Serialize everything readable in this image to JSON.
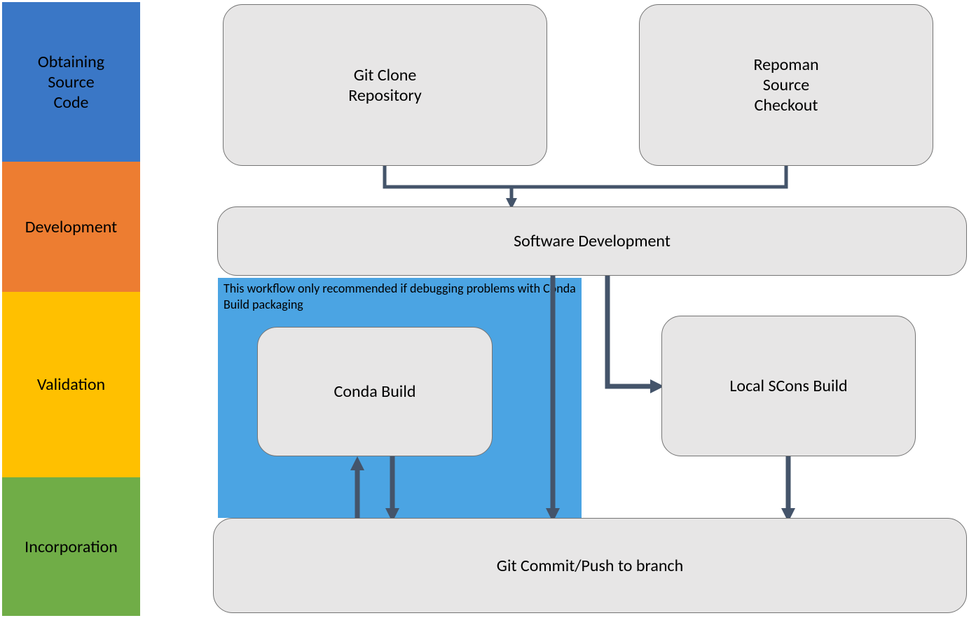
{
  "phases": {
    "obtain": "Obtaining\nSource\nCode",
    "dev": "Development",
    "validate": "Validation",
    "incorp": "Incorporation"
  },
  "boxes": {
    "git_clone": "Git Clone\nRepository",
    "repoman": "Repoman\nSource\nCheckout",
    "software_dev": "Software Development",
    "conda_build": "Conda Build",
    "local_scons": "Local SCons Build",
    "git_commit": "Git Commit/Push to branch"
  },
  "callout": {
    "note": "This workflow only recommended if debugging problems with Conda Build packaging"
  },
  "colors": {
    "arrow": "#44546a",
    "box_fill": "#e7e6e6",
    "callout_fill": "#4ba4e3"
  }
}
